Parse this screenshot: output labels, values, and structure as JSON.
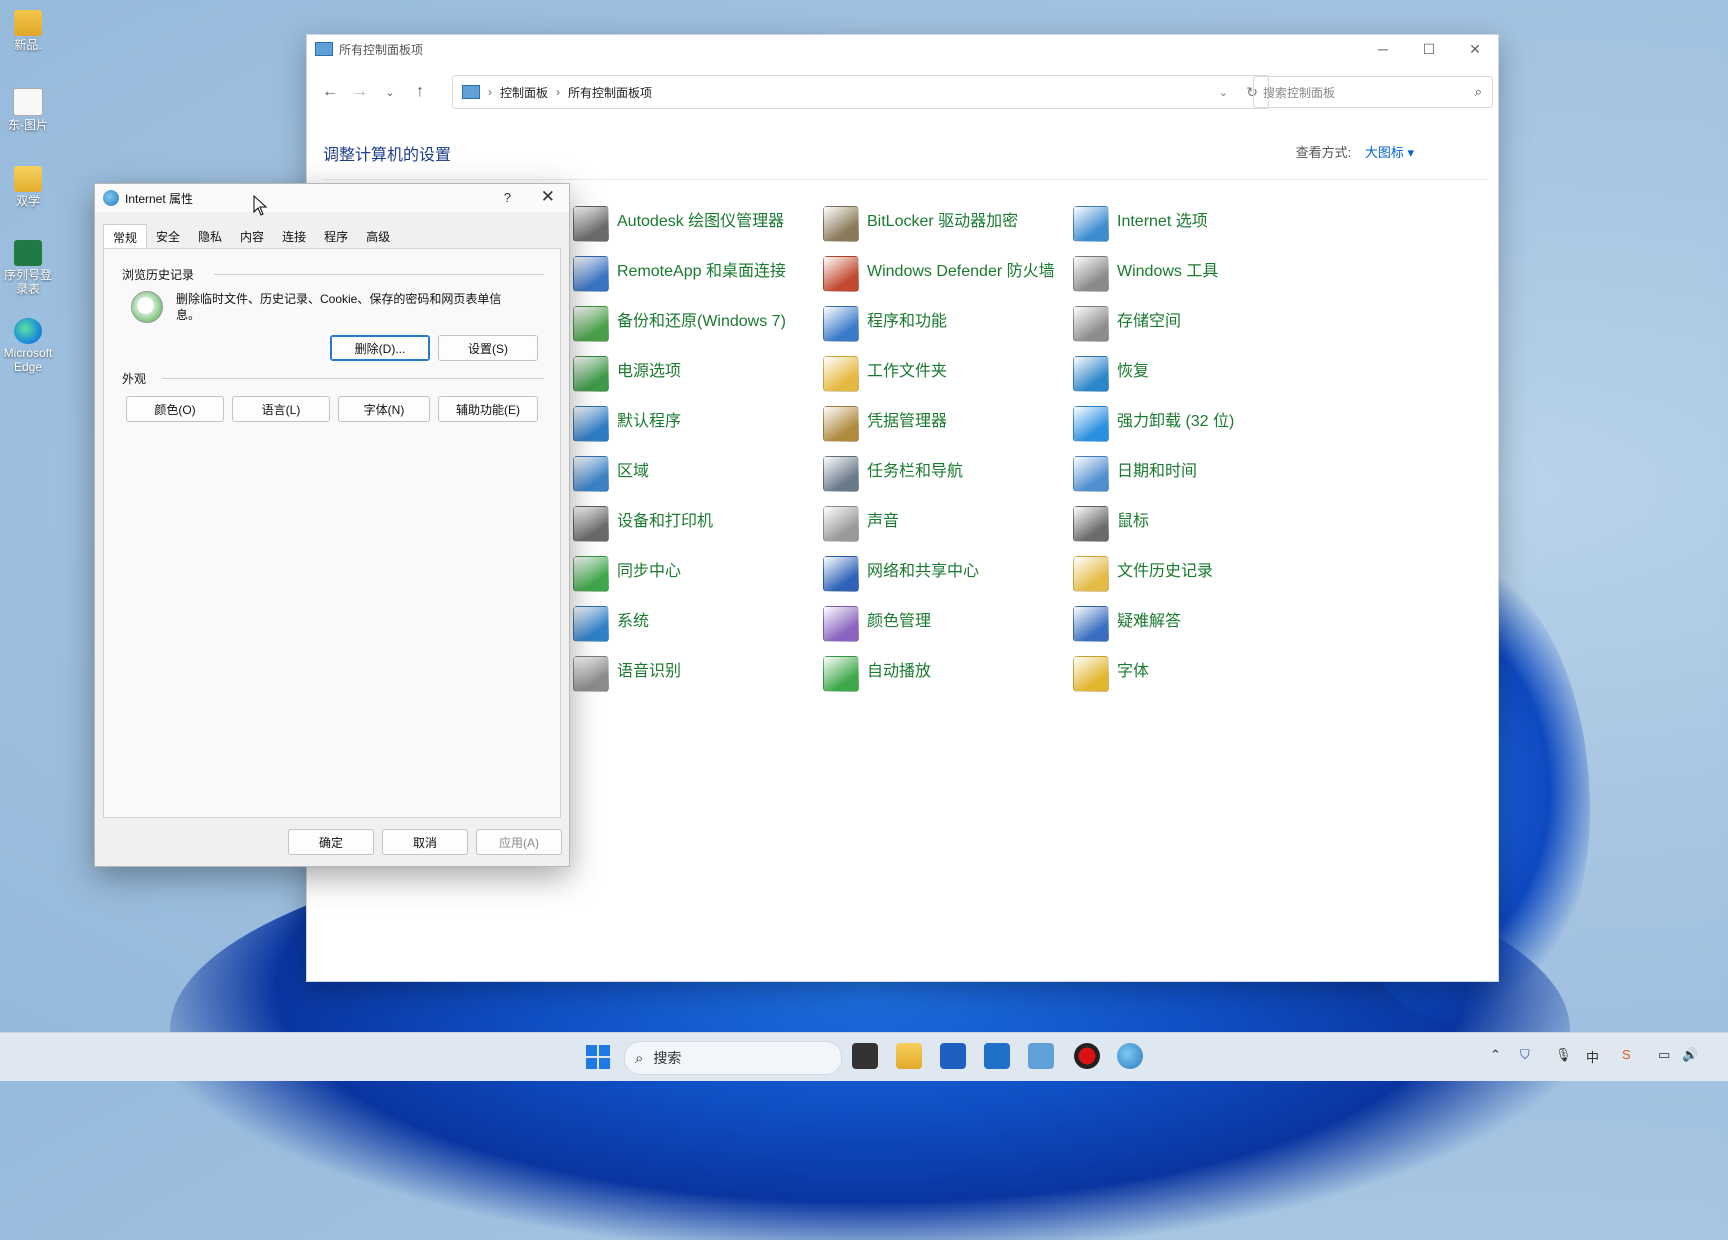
{
  "desktop": {
    "icons": [
      {
        "label": "新品.",
        "icon": "folder-icon"
      },
      {
        "label": "东-图片",
        "icon": "picture-shortcut-icon"
      },
      {
        "label": "双学",
        "icon": "folder-icon"
      },
      {
        "label": "序列号登录表",
        "icon": "excel-icon"
      },
      {
        "label": "Microsoft Edge",
        "icon": "edge-icon"
      }
    ]
  },
  "control_panel": {
    "title": "所有控制面板项",
    "address": {
      "crumbs": [
        "控制面板",
        "所有控制面板项"
      ]
    },
    "search_placeholder": "搜索控制面板",
    "heading": "调整计算机的设置",
    "view_label": "查看方式:",
    "view_value": "大图标",
    "items": [
      {
        "label": "Autodesk 绘图仪管理器",
        "icon": "plotter-icon",
        "color": "#6b6b6b"
      },
      {
        "label": "BitLocker 驱动器加密",
        "icon": "bitlocker-key-icon",
        "color": "#8a7a5a"
      },
      {
        "label": "Internet 选项",
        "icon": "internet-options-icon",
        "color": "#3c8ccf"
      },
      {
        "label": "RemoteApp 和桌面连接",
        "icon": "remoteapp-icon",
        "color": "#3a74c4"
      },
      {
        "label": "Windows Defender 防火墙",
        "icon": "firewall-icon",
        "color": "#c0492f"
      },
      {
        "label": "Windows 工具",
        "icon": "tools-gear-icon",
        "color": "#8a8a8a"
      },
      {
        "label": "备份和还原(Windows 7)",
        "icon": "backup-icon",
        "color": "#4aa04a"
      },
      {
        "label": "程序和功能",
        "icon": "programs-icon",
        "color": "#3a7bc8"
      },
      {
        "label": "存储空间",
        "icon": "storage-icon",
        "color": "#8d8d8d"
      },
      {
        "label": "电源选项",
        "icon": "power-icon",
        "color": "#3e9a48"
      },
      {
        "label": "工作文件夹",
        "icon": "work-folders-icon",
        "color": "#e5b840"
      },
      {
        "label": "恢复",
        "icon": "recovery-icon",
        "color": "#2d86c9"
      },
      {
        "label": "默认程序",
        "icon": "default-programs-icon",
        "color": "#2f7dc7"
      },
      {
        "label": "凭据管理器",
        "icon": "credential-manager-icon",
        "color": "#b08a3e"
      },
      {
        "label": "强力卸载 (32 位)",
        "icon": "uninstall-icon",
        "color": "#2a90e0"
      },
      {
        "label": "区域",
        "icon": "globe-clock-icon",
        "color": "#3b82c6"
      },
      {
        "label": "任务栏和导航",
        "icon": "taskbar-icon",
        "color": "#6b7a8a"
      },
      {
        "label": "日期和时间",
        "icon": "calendar-clock-icon",
        "color": "#4f8fd0"
      },
      {
        "label": "设备和打印机",
        "icon": "printer-icon",
        "color": "#6a6a6a"
      },
      {
        "label": "声音",
        "icon": "speaker-icon",
        "color": "#9a9a9a"
      },
      {
        "label": "鼠标",
        "icon": "mouse-icon",
        "color": "#6b6b6b"
      },
      {
        "label": "同步中心",
        "icon": "sync-icon",
        "color": "#3ea84a"
      },
      {
        "label": "网络和共享中心",
        "icon": "network-icon",
        "color": "#2f63b8"
      },
      {
        "label": "文件历史记录",
        "icon": "file-history-icon",
        "color": "#e4bb45"
      },
      {
        "label": "系统",
        "icon": "system-monitor-icon",
        "color": "#2f80c8"
      },
      {
        "label": "颜色管理",
        "icon": "color-management-icon",
        "color": "#8a64c0"
      },
      {
        "label": "疑难解答",
        "icon": "troubleshoot-icon",
        "color": "#3a6fbf"
      },
      {
        "label": "语音识别",
        "icon": "microphone-icon",
        "color": "#8c8c8c"
      },
      {
        "label": "自动播放",
        "icon": "autoplay-icon",
        "color": "#3ea84a"
      },
      {
        "label": "字体",
        "icon": "fonts-icon",
        "color": "#e2b52e"
      }
    ]
  },
  "dialog": {
    "title": "Internet 属性",
    "help": "?",
    "tabs": [
      "常规",
      "安全",
      "隐私",
      "内容",
      "连接",
      "程序",
      "高级"
    ],
    "active_tab": "常规",
    "history_group": "浏览历史记录",
    "history_desc": "删除临时文件、历史记录、Cookie、保存的密码和网页表单信息。",
    "delete_btn": "删除(D)...",
    "settings_btn": "设置(S)",
    "appearance_group": "外观",
    "colors_btn": "颜色(O)",
    "languages_btn": "语言(L)",
    "fonts_btn": "字体(N)",
    "accessibility_btn": "辅助功能(E)",
    "ok_btn": "确定",
    "cancel_btn": "取消",
    "apply_btn": "应用(A)"
  },
  "taskbar": {
    "search": "搜索",
    "tray_ime": "中"
  }
}
